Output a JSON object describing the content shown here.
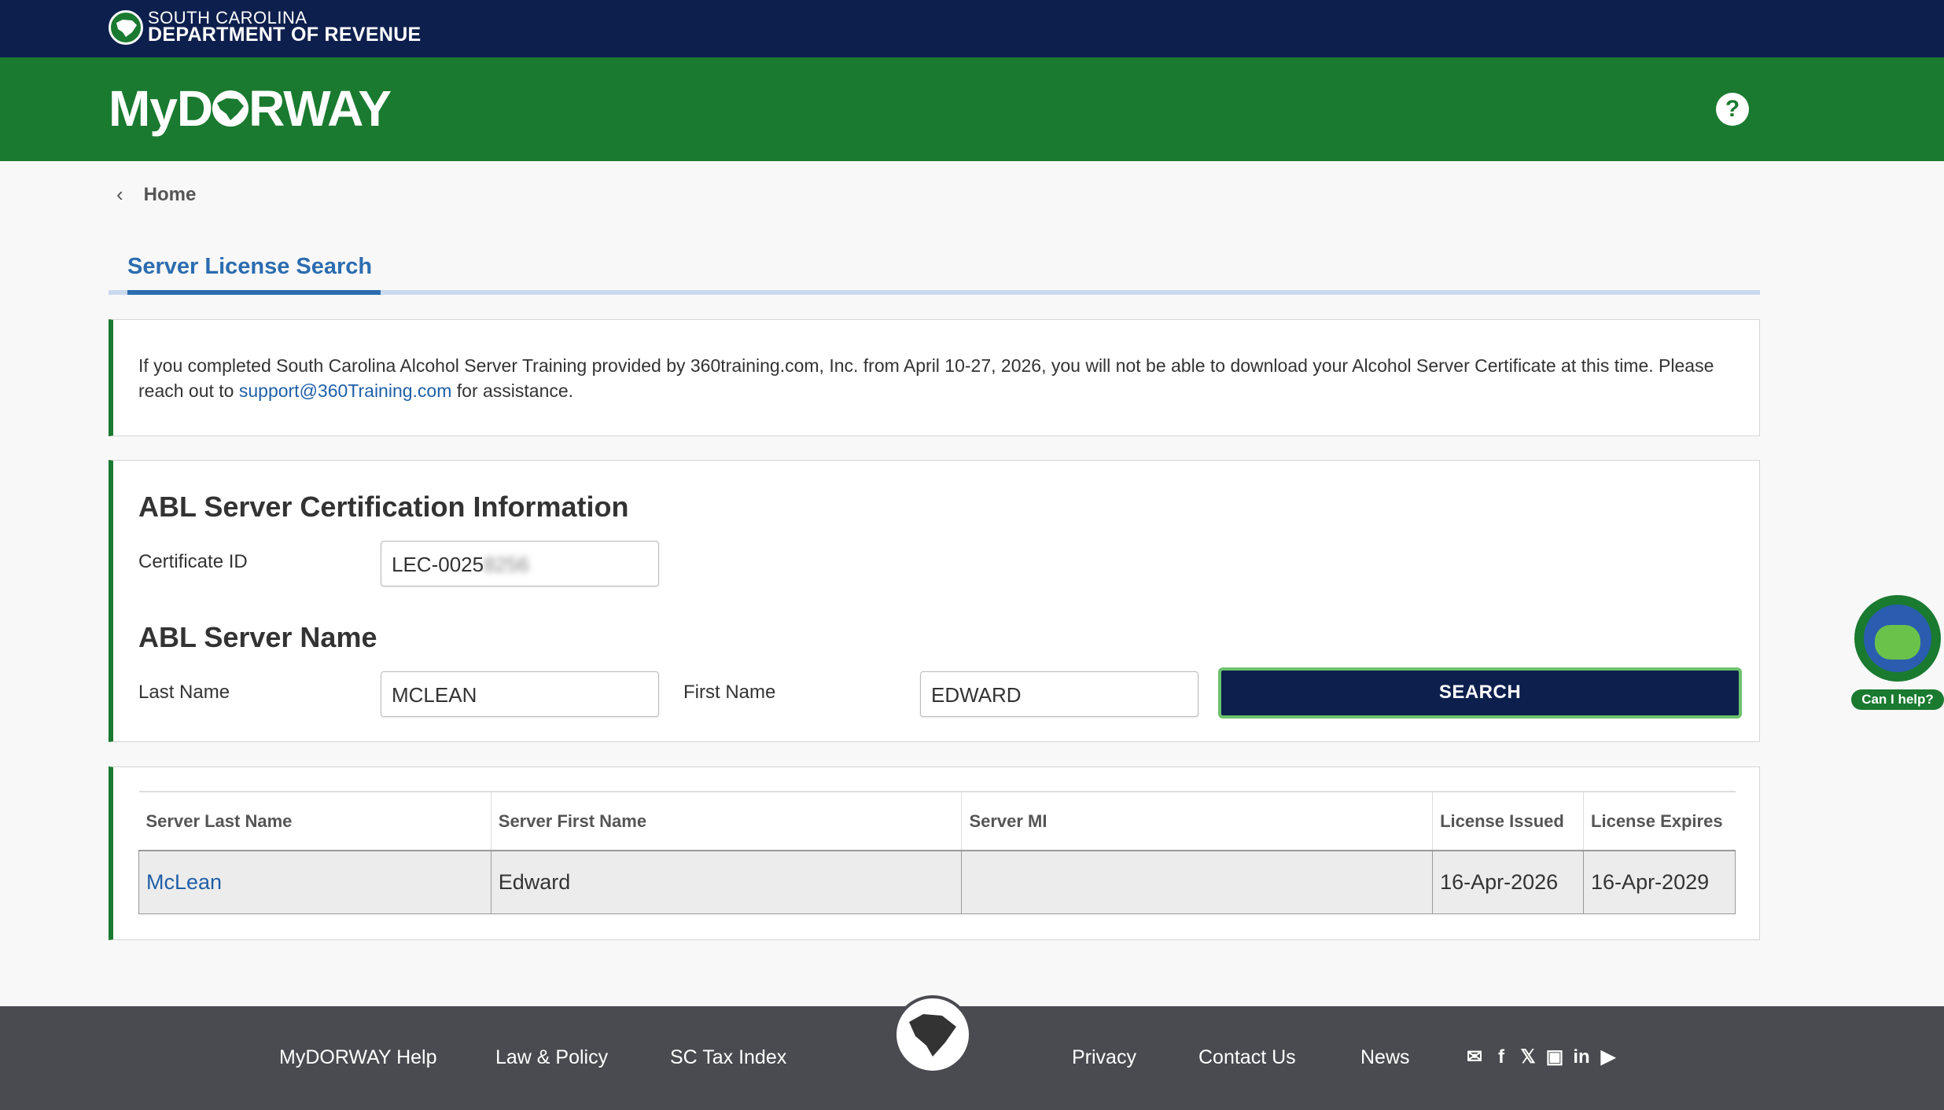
{
  "header": {
    "dept_line1": "SOUTH CAROLINA",
    "dept_line2": "DEPARTMENT OF REVENUE",
    "brand_left": "MyD",
    "brand_right": "RWAY",
    "help_glyph": "?"
  },
  "breadcrumb": {
    "home": "Home"
  },
  "tab": {
    "label": "Server License Search"
  },
  "notice": {
    "text_before": "If you completed South Carolina Alcohol Server Training provided by 360training.com, Inc. from April 10-27, 2026, you will not be able to download your Alcohol Server Certificate at this time. Please reach out to ",
    "link": "support@360Training.com",
    "text_after": " for assistance."
  },
  "cert_section": {
    "title": "ABL Server Certification Information",
    "certificate_id_label": "Certificate ID",
    "certificate_id_value": "LEC-0025",
    "certificate_id_redacted": "8256"
  },
  "name_section": {
    "title": "ABL Server Name",
    "last_name_label": "Last Name",
    "last_name_value": "MCLEAN",
    "first_name_label": "First Name",
    "first_name_value": "EDWARD",
    "search_label": "SEARCH"
  },
  "results": {
    "columns": [
      "Server Last Name",
      "Server First Name",
      "Server MI",
      "License Issued",
      "License Expires"
    ],
    "rows": [
      {
        "last": "McLean",
        "first": "Edward",
        "mi": "",
        "issued": "16-Apr-2026",
        "expires": "16-Apr-2029"
      }
    ]
  },
  "chatbot": {
    "label": "Can I help?"
  },
  "footer": {
    "links": [
      "MyDORWAY Help",
      "Law & Policy",
      "SC Tax Index",
      "Privacy",
      "Contact Us",
      "News"
    ],
    "social_icons": [
      "mail-icon",
      "facebook-icon",
      "x-icon",
      "instagram-icon",
      "linkedin-icon",
      "youtube-icon"
    ]
  },
  "colors": {
    "navy": "#0d1f4d",
    "green": "#1a7a30",
    "link_blue": "#1f5fa8",
    "tab_blue": "#2b6cb0",
    "footer_gray": "#4a4b50"
  }
}
